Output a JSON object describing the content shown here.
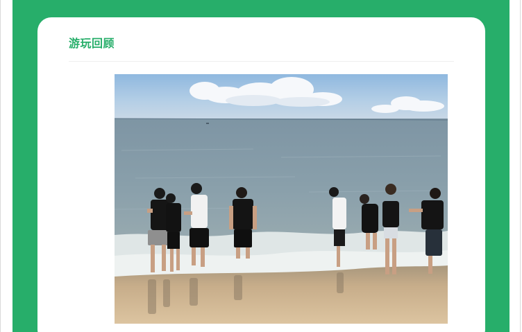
{
  "section": {
    "title": "游玩回顾"
  },
  "photo": {
    "subject": "group-beach-photo-icon"
  },
  "colors": {
    "accent": "#27ae6a",
    "card": "#ffffff"
  }
}
